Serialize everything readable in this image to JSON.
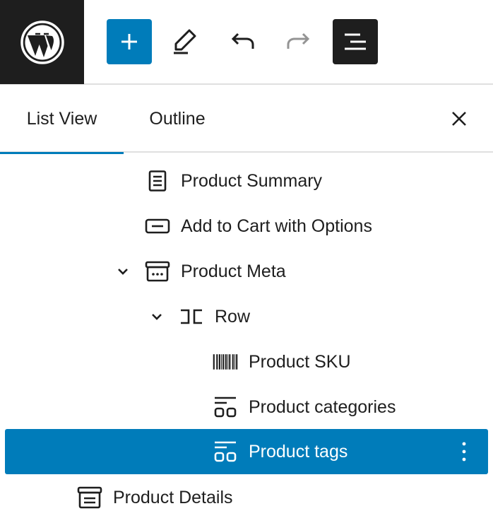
{
  "toolbar": {
    "logo": "wordpress-logo",
    "buttons": [
      {
        "name": "add-block",
        "icon": "plus-icon"
      },
      {
        "name": "tools",
        "icon": "pencil-icon"
      },
      {
        "name": "undo",
        "icon": "undo-icon"
      },
      {
        "name": "redo",
        "icon": "redo-icon"
      },
      {
        "name": "document-overview",
        "icon": "list-view-icon"
      }
    ]
  },
  "panel": {
    "tabs": [
      {
        "label": "List View",
        "active": true
      },
      {
        "label": "Outline",
        "active": false
      }
    ],
    "close_icon": "close-icon"
  },
  "blocks": [
    {
      "label": "Product Summary",
      "icon": "document-icon",
      "level": 2,
      "expanded": null,
      "selected": false
    },
    {
      "label": "Add to Cart with Options",
      "icon": "button-icon",
      "level": 2,
      "expanded": null,
      "selected": false
    },
    {
      "label": "Product Meta",
      "icon": "archive-icon",
      "level": 2,
      "expanded": true,
      "selected": false
    },
    {
      "label": "Row",
      "icon": "row-icon",
      "level": 3,
      "expanded": true,
      "selected": false
    },
    {
      "label": "Product SKU",
      "icon": "barcode-icon",
      "level": 4,
      "expanded": null,
      "selected": false
    },
    {
      "label": "Product categories",
      "icon": "terms-icon",
      "level": 4,
      "expanded": null,
      "selected": false
    },
    {
      "label": "Product tags",
      "icon": "terms-icon",
      "level": 4,
      "expanded": null,
      "selected": true
    },
    {
      "label": "Product Details",
      "icon": "details-icon",
      "level": 1,
      "expanded": null,
      "selected": false
    }
  ],
  "colors": {
    "accent": "#007cba",
    "dark": "#1e1e1e",
    "disabled": "#949494",
    "border": "#e0e0e0"
  }
}
